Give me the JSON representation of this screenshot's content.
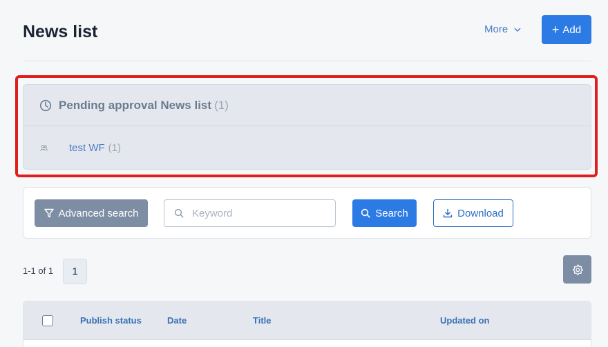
{
  "header": {
    "title": "News list",
    "more_label": "More",
    "add_label": "Add"
  },
  "pending": {
    "title": "Pending approval News list",
    "count": "(1)",
    "items": [
      {
        "label": "test WF",
        "count": "(1)"
      }
    ]
  },
  "search": {
    "advanced_label": "Advanced search",
    "keyword_placeholder": "Keyword",
    "keyword_value": "",
    "search_label": "Search",
    "download_label": "Download"
  },
  "pagination": {
    "info": "1-1 of 1",
    "current_page": "1"
  },
  "table": {
    "columns": [
      "Publish status",
      "Date",
      "Title",
      "Updated on"
    ]
  },
  "colors": {
    "primary": "#2c7be5",
    "secondary": "#7d8ea4",
    "highlight": "#e01e1e",
    "link": "#4a7bc4"
  },
  "icons": {
    "clock": "clock-icon",
    "users": "users-icon",
    "filter": "filter-icon",
    "search": "search-icon",
    "download": "download-icon",
    "gear": "gear-icon",
    "chevron": "chevron-down-icon",
    "plus": "plus-icon"
  }
}
